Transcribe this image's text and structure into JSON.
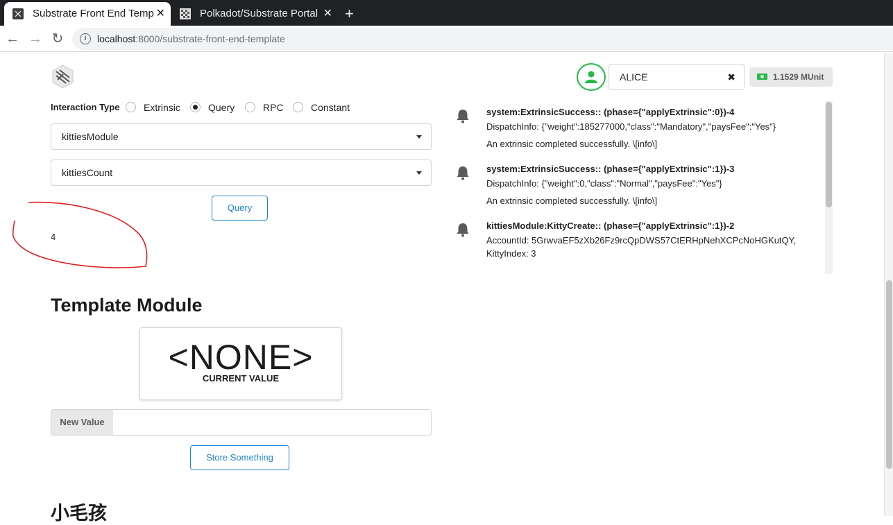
{
  "browser": {
    "tabs": [
      {
        "title": "Substrate Front End Template",
        "active": true
      },
      {
        "title": "Polkadot/Substrate Portal",
        "active": false
      }
    ],
    "url_host": "localhost",
    "url_rest": ":8000/substrate-front-end-template"
  },
  "account": {
    "name": "ALICE",
    "balance": "1.1529 MUnit"
  },
  "interaction": {
    "label": "Interaction Type",
    "options": [
      "Extrinsic",
      "Query",
      "RPC",
      "Constant"
    ],
    "selected": "Query",
    "pallet": "kittiesModule",
    "callable": "kittiesCount",
    "button": "Query",
    "result": "4"
  },
  "events": [
    {
      "summary": "system:ExtrinsicSuccess:: (phase={\"applyExtrinsic\":0})-4",
      "meta": "DispatchInfo: {\"weight\":185277000,\"class\":\"Mandatory\",\"paysFee\":\"Yes\"}",
      "desc": "An extrinsic completed successfully. \\[info\\]"
    },
    {
      "summary": "system:ExtrinsicSuccess:: (phase={\"applyExtrinsic\":1})-3",
      "meta": "DispatchInfo: {\"weight\":0,\"class\":\"Normal\",\"paysFee\":\"Yes\"}",
      "desc": "An extrinsic completed successfully. \\[info\\]"
    },
    {
      "summary": "kittiesModule:KittyCreate:: (phase={\"applyExtrinsic\":1})-2",
      "meta": "AccountId: 5GrwvaEF5zXb26Fz9rcQpDWS57CtERHpNehXCPcNoHGKutQY,",
      "meta2": "KittyIndex: 3"
    }
  ],
  "template_module": {
    "title": "Template Module",
    "value": "<NONE>",
    "caption": "CURRENT VALUE",
    "input_label": "New Value",
    "input_value": "",
    "button": "Store Something"
  },
  "next_section": {
    "title": "小毛孩"
  },
  "colors": {
    "accent": "#2185d0",
    "green": "#21ba45",
    "annotation": "#e02020"
  }
}
